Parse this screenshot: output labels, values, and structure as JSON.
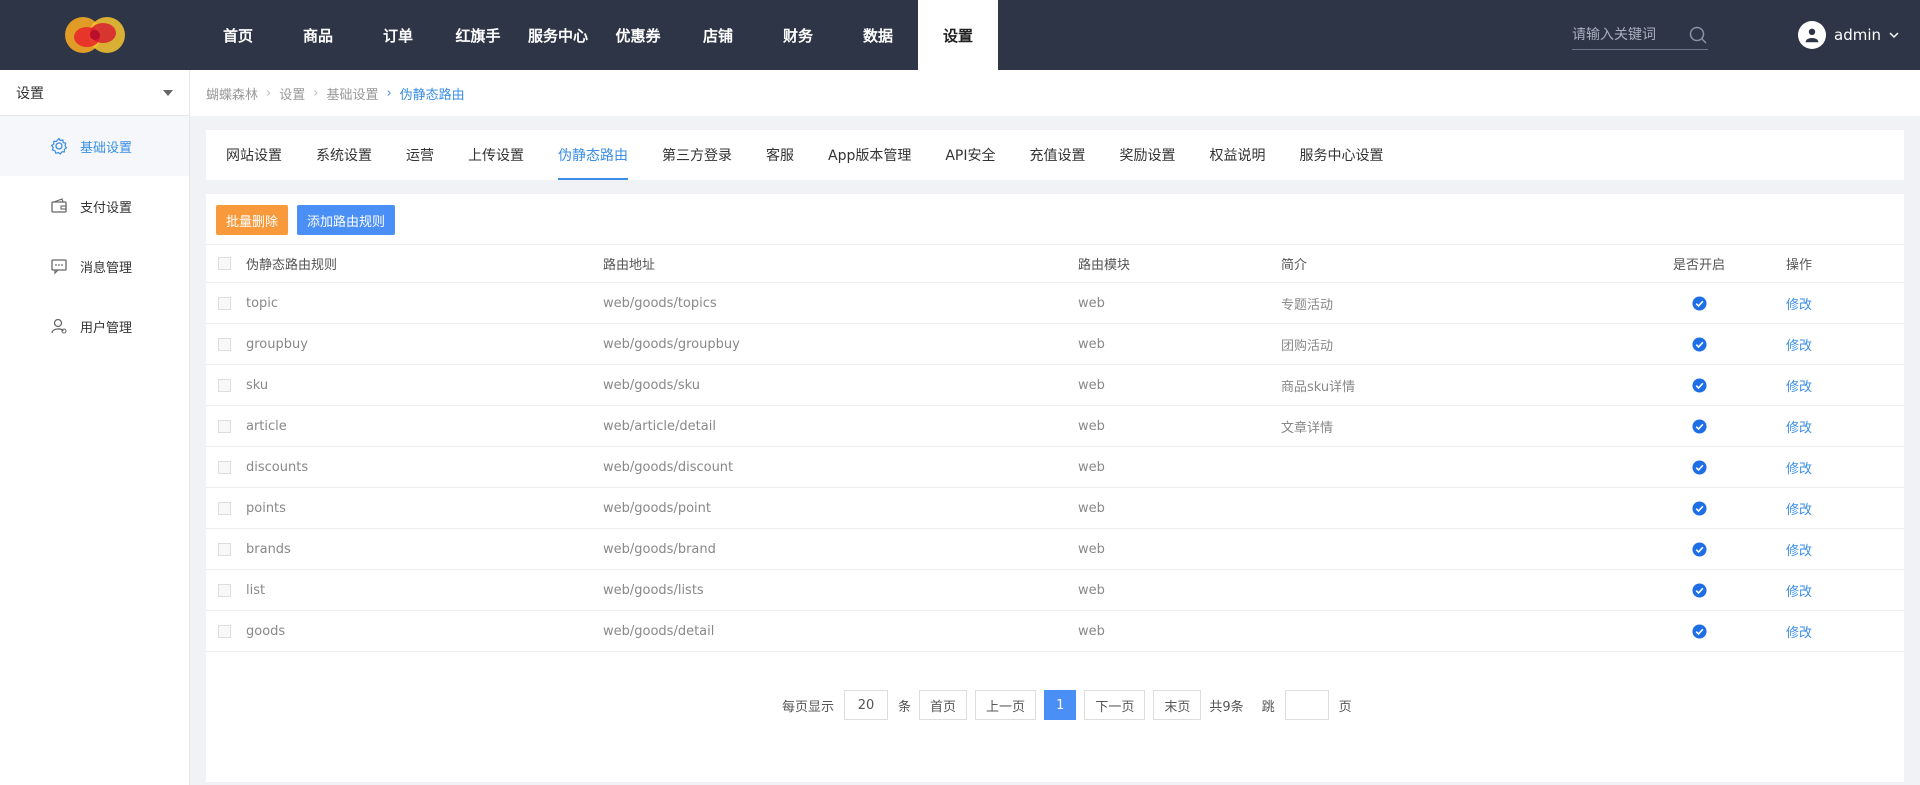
{
  "nav": {
    "items": [
      "首页",
      "商品",
      "订单",
      "红旗手",
      "服务中心",
      "优惠券",
      "店铺",
      "财务",
      "数据",
      "设置"
    ],
    "active_index": 9
  },
  "search": {
    "placeholder": "请输入关键词"
  },
  "user": {
    "name": "admin"
  },
  "sidebar": {
    "select_label": "设置",
    "items": [
      {
        "label": "基础设置",
        "icon": "gear-icon"
      },
      {
        "label": "支付设置",
        "icon": "wallet-icon"
      },
      {
        "label": "消息管理",
        "icon": "message-icon"
      },
      {
        "label": "用户管理",
        "icon": "user-icon"
      }
    ],
    "active_index": 0
  },
  "breadcrumb": [
    "蝴蝶森林",
    "设置",
    "基础设置",
    "伪静态路由"
  ],
  "tabs": {
    "items": [
      "网站设置",
      "系统设置",
      "运营",
      "上传设置",
      "伪静态路由",
      "第三方登录",
      "客服",
      "App版本管理",
      "API安全",
      "充值设置",
      "奖励设置",
      "权益说明",
      "服务中心设置"
    ],
    "active_index": 4
  },
  "toolbar": {
    "batch_delete": "批量删除",
    "add_rule": "添加路由规则"
  },
  "table": {
    "headers": [
      "伪静态路由规则",
      "路由地址",
      "路由模块",
      "简介",
      "是否开启",
      "操作"
    ],
    "rows": [
      {
        "rule": "topic",
        "address": "web/goods/topics",
        "module": "web",
        "desc": "专题活动",
        "open": true,
        "op": "修改"
      },
      {
        "rule": "groupbuy",
        "address": "web/goods/groupbuy",
        "module": "web",
        "desc": "团购活动",
        "open": true,
        "op": "修改"
      },
      {
        "rule": "sku",
        "address": "web/goods/sku",
        "module": "web",
        "desc": "商品sku详情",
        "open": true,
        "op": "修改"
      },
      {
        "rule": "article",
        "address": "web/article/detail",
        "module": "web",
        "desc": "文章详情",
        "open": true,
        "op": "修改"
      },
      {
        "rule": "discounts",
        "address": "web/goods/discount",
        "module": "web",
        "desc": "",
        "open": true,
        "op": "修改"
      },
      {
        "rule": "points",
        "address": "web/goods/point",
        "module": "web",
        "desc": "",
        "open": true,
        "op": "修改"
      },
      {
        "rule": "brands",
        "address": "web/goods/brand",
        "module": "web",
        "desc": "",
        "open": true,
        "op": "修改"
      },
      {
        "rule": "list",
        "address": "web/goods/lists",
        "module": "web",
        "desc": "",
        "open": true,
        "op": "修改"
      },
      {
        "rule": "goods",
        "address": "web/goods/detail",
        "module": "web",
        "desc": "",
        "open": true,
        "op": "修改"
      }
    ]
  },
  "pagination": {
    "per_page_label": "每页显示",
    "per_page_value": "20",
    "per_page_unit": "条",
    "first": "首页",
    "prev": "上一页",
    "current": "1",
    "next": "下一页",
    "last": "末页",
    "total": "共9条",
    "jump_label": "跳",
    "jump_value": "",
    "page_unit": "页"
  },
  "colors": {
    "topbar": "#2e3546",
    "accent": "#3a8ee6",
    "orange": "#f89a3c",
    "blue": "#4a8ff5"
  }
}
